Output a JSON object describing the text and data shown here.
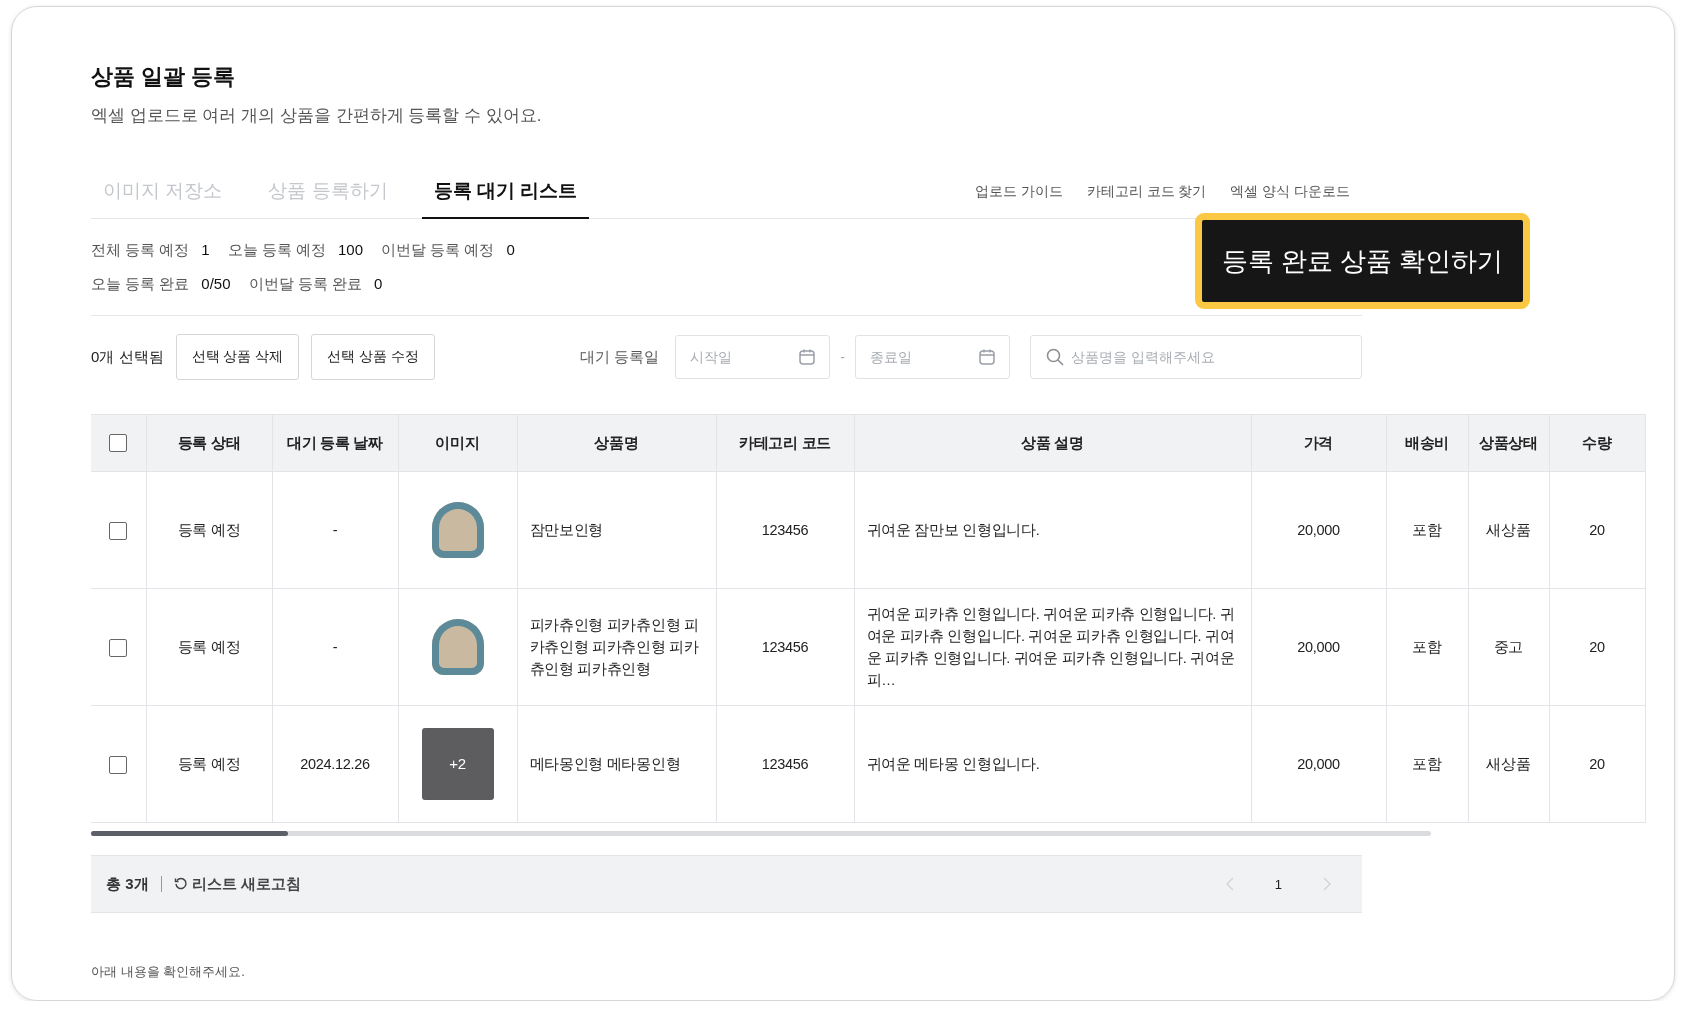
{
  "header": {
    "title": "상품 일괄 등록",
    "subtitle": "엑셀 업로드로 여러 개의 상품을 간편하게 등록할 수 있어요."
  },
  "tabs": [
    {
      "label": "이미지 저장소",
      "selected": false
    },
    {
      "label": "상품 등록하기",
      "selected": false
    },
    {
      "label": "등록 대기 리스트",
      "selected": true
    }
  ],
  "links": [
    "업로드 가이드",
    "카테고리 코드 찾기",
    "엑셀 양식 다운로드"
  ],
  "stats": [
    [
      {
        "label": "전체 등록 예정",
        "value": "1"
      },
      {
        "label": "오늘 등록 예정",
        "value": "100"
      },
      {
        "label": "이번달 등록 예정",
        "value": "0"
      }
    ],
    [
      {
        "label": "오늘 등록 완료",
        "value": "0/50"
      },
      {
        "label": "이번달 등록 완료",
        "value": "0"
      }
    ]
  ],
  "highlight_button": {
    "label": "등록 완료 상품 확인하기"
  },
  "filter": {
    "selected_count": "0개 선택됨",
    "buttons": [
      "선택 상품 삭제",
      "선택 상품 수정"
    ],
    "date_label": "대기 등록일",
    "start_placeholder": "시작일",
    "separator": "-",
    "end_placeholder": "종료일",
    "search_placeholder": "상품명을 입력해주세요"
  },
  "table": {
    "select_all": {
      "checked": false
    },
    "columns": [
      "등록 상태",
      "대기 등록 날짜",
      "이미지",
      "상품명",
      "카테고리 코드",
      "상품 설명",
      "가격",
      "배송비",
      "상품상태",
      "수량"
    ],
    "rows": [
      {
        "checked": false,
        "status": "등록 예정",
        "date": "-",
        "image": {
          "kind": "photo"
        },
        "name": "잠만보인형",
        "category_code": "123456",
        "description": "귀여운 잠만보 인형입니다.",
        "price": "20,000",
        "shipping": "포함",
        "condition": "새상품",
        "quantity": "20"
      },
      {
        "checked": false,
        "status": "등록 예정",
        "date": "-",
        "image": {
          "kind": "photo"
        },
        "name": "피카츄인형 피카츄인형 피카츄인형 피카츄인형 피카츄인형 피카츄인형",
        "category_code": "123456",
        "description": "귀여운 피카츄 인형입니다. 귀여운 피카츄 인형입니다. 귀여운 피카츄 인형입니다. 귀여운 피카츄 인형입니다. 귀여운 피카츄 인형입니다. 귀여운 피카츄 인형입니다. 귀여운 피…",
        "price": "20,000",
        "shipping": "포함",
        "condition": "중고",
        "quantity": "20"
      },
      {
        "checked": false,
        "status": "등록 예정",
        "date": "2024.12.26",
        "image": {
          "kind": "more",
          "count": "+2"
        },
        "name": "메타몽인형 메타몽인형",
        "category_code": "123456",
        "description": "귀여운 메타몽 인형입니다.",
        "price": "20,000",
        "shipping": "포함",
        "condition": "새상품",
        "quantity": "20"
      }
    ]
  },
  "footer": {
    "total": "총 3개",
    "refresh": "리스트 새로고침",
    "pages": [
      {
        "label": "1",
        "selected": true
      }
    ],
    "prev": {
      "disabled": true
    },
    "next": {
      "disabled": true
    }
  },
  "note": "아래 내용을 확인해주세요."
}
